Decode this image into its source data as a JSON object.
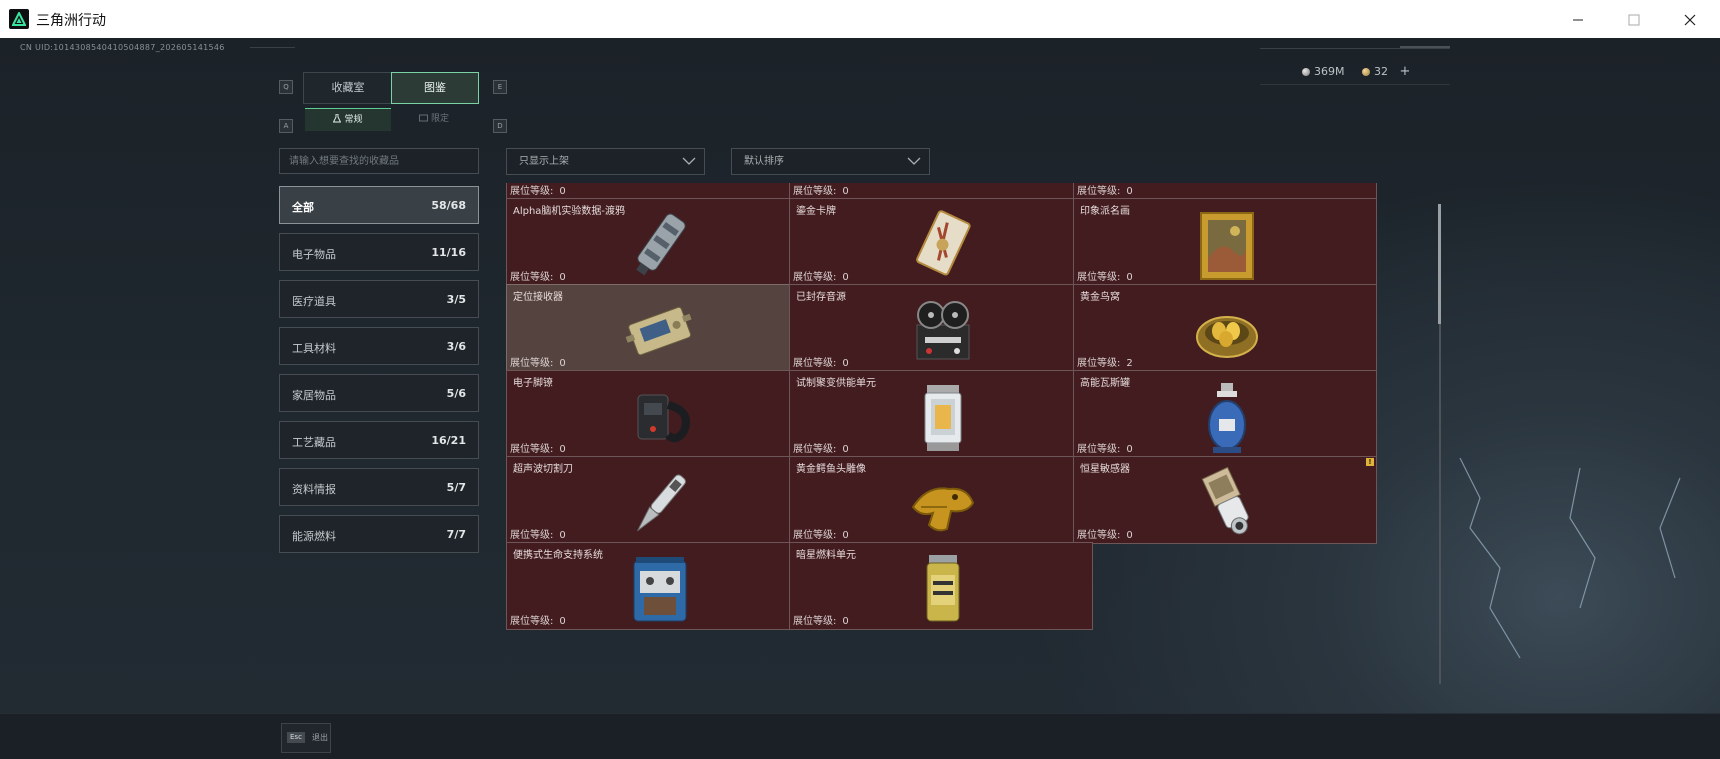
{
  "window": {
    "title": "三角洲行动",
    "minimize_icon": "minimize-icon",
    "maximize_icon": "maximize-icon",
    "close_icon": "close-icon"
  },
  "header": {
    "uid": "CN UID:1014308540410504887_202605141546",
    "currency": [
      {
        "icon": "silver-coin-icon",
        "value": "369M"
      },
      {
        "icon": "gold-coin-icon",
        "value": "32"
      }
    ],
    "add_label": "+"
  },
  "tabs": {
    "left_key": "Q",
    "right_key": "E",
    "items": [
      {
        "label": "收藏室",
        "active": false
      },
      {
        "label": "图鉴",
        "active": true
      }
    ]
  },
  "subtabs": {
    "left_key": "A",
    "right_key": "D",
    "items": [
      {
        "label": "常规",
        "icon": "flask-icon",
        "active": true
      },
      {
        "label": "限定",
        "icon": "limited-icon",
        "active": false
      }
    ]
  },
  "search": {
    "placeholder": "请输入想要查找的收藏品",
    "value": ""
  },
  "filters": {
    "display": "只显示上架",
    "sort": "默认排序"
  },
  "categories": [
    {
      "label": "全部",
      "count": "58/68",
      "active": true
    },
    {
      "label": "电子物品",
      "count": "11/16",
      "active": false
    },
    {
      "label": "医疗道具",
      "count": "3/5",
      "active": false
    },
    {
      "label": "工具材料",
      "count": "3/6",
      "active": false
    },
    {
      "label": "家居物品",
      "count": "5/6",
      "active": false
    },
    {
      "label": "工艺藏品",
      "count": "16/21",
      "active": false
    },
    {
      "label": "资料情报",
      "count": "5/7",
      "active": false
    },
    {
      "label": "能源燃料",
      "count": "7/7",
      "active": false
    }
  ],
  "level_label": "展位等级:",
  "items": [
    {
      "name": "",
      "level": "0",
      "art": "partial"
    },
    {
      "name": "",
      "level": "0",
      "art": "partial"
    },
    {
      "name": "",
      "level": "0",
      "art": "partial"
    },
    {
      "name": "Alpha脑机实验数据-渡鸦",
      "level": "0",
      "art": "canister",
      "badge": "!"
    },
    {
      "name": "鎏金卡牌",
      "level": "0",
      "art": "card"
    },
    {
      "name": "印象派名画",
      "level": "0",
      "art": "painting"
    },
    {
      "name": "定位接收器",
      "level": "0",
      "art": "receiver",
      "highlight": true
    },
    {
      "name": "已封存音源",
      "level": "0",
      "art": "reel"
    },
    {
      "name": "黄金鸟窝",
      "level": "2",
      "art": "nest"
    },
    {
      "name": "电子脚镣",
      "level": "0",
      "art": "anklet"
    },
    {
      "name": "试制聚变供能单元",
      "level": "0",
      "art": "fusion"
    },
    {
      "name": "高能瓦斯罐",
      "level": "0",
      "art": "gas"
    },
    {
      "name": "超声波切割刀",
      "level": "0",
      "art": "knife"
    },
    {
      "name": "黄金鳄鱼头雕像",
      "level": "0",
      "art": "croc"
    },
    {
      "name": "恒星敏感器",
      "level": "0",
      "art": "sensor",
      "badge": "!"
    },
    {
      "name": "便携式生命支持系统",
      "level": "0",
      "art": "lifesupport"
    },
    {
      "name": "暗星燃料单元",
      "level": "0",
      "art": "fuelcell"
    }
  ],
  "footer": {
    "esc_key": "Esc",
    "back_label": "退出"
  }
}
